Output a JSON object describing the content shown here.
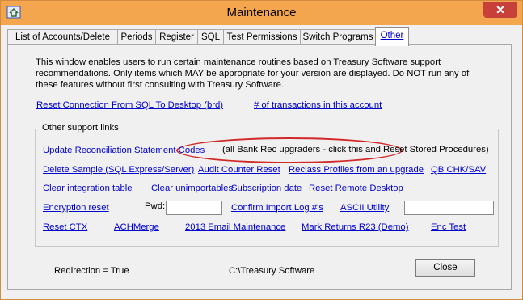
{
  "window": {
    "title": "Maintenance",
    "close_glyph": "✕"
  },
  "tabs": [
    "List of Accounts/Delete",
    "Periods",
    "Register",
    "SQL",
    "Test Permissions",
    "Switch Programs",
    "Other"
  ],
  "active_tab": "Other",
  "description": "This window enables users to run certain maintenance routines based on Treasury Software support recommendations.  Only items which MAY be appropriate for your version are displayed.  Do NOT run any of these features without first consulting with Treasury Software.",
  "links_top": {
    "reset_connection": "Reset Connection From SQL To Desktop (brd)",
    "transactions_count": "# of transactions in this account"
  },
  "support": {
    "group_label": "Other support links",
    "update_recon": "Update Reconciliation Statement Codes",
    "update_recon_note": "(all Bank Rec upgraders - click this and Reset Stored Procedures)",
    "delete_sample": "Delete Sample (SQL Express/Server)",
    "audit_counter": "Audit Counter Reset",
    "reclass_profiles": "Reclass Profiles from an upgrade",
    "qb_chk": "QB CHK/SAV",
    "clear_integration": "Clear integration table",
    "clear_unimportables": "Clear unimportables",
    "subscription_date": "Subscription date",
    "reset_remote": "Reset Remote Desktop",
    "encryption_reset": "Encryption reset",
    "pwd_label": "Pwd:",
    "pwd_value": "",
    "confirm_import": "Confirm Import Log #'s",
    "ascii_utility": "ASCII Utility",
    "ascii_value": "",
    "reset_ctx": "Reset CTX",
    "achmerge": "ACHMerge",
    "email_2013": "2013 Email Maintenance",
    "mark_returns": "Mark Returns R23 (Demo)",
    "enc_test": "Enc Test"
  },
  "footer": {
    "redirection": "Redirection = True",
    "path": "C:\\Treasury Software",
    "close_button": "Close"
  },
  "colors": {
    "titlebar": "#f4a64e",
    "link": "#0000d0",
    "highlight_oval": "#d22828",
    "close_button": "#c7413a"
  }
}
